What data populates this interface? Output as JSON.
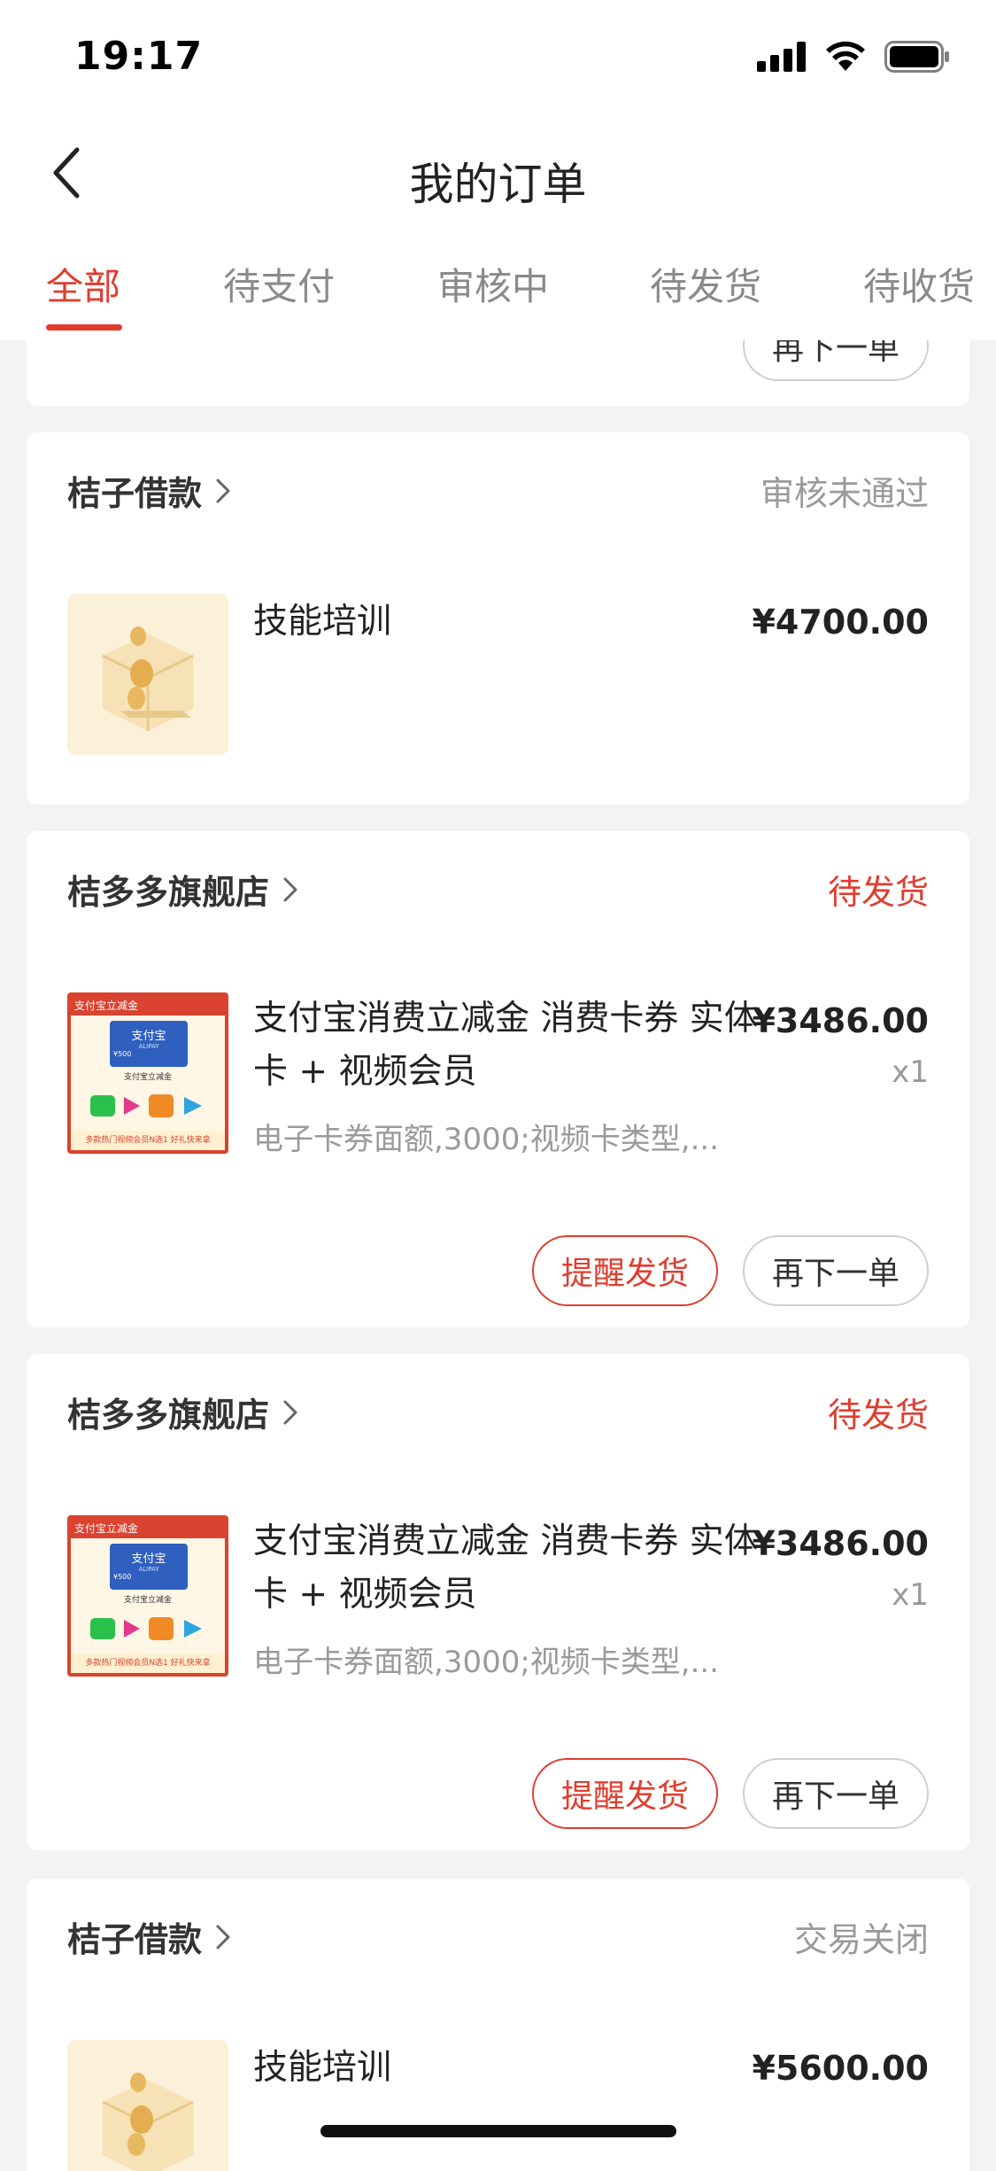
{
  "status_bar": {
    "time": "19:17"
  },
  "nav": {
    "title": "我的订单"
  },
  "tabs": [
    {
      "label": "全部",
      "active": true
    },
    {
      "label": "待支付",
      "active": false
    },
    {
      "label": "审核中",
      "active": false
    },
    {
      "label": "待发货",
      "active": false
    },
    {
      "label": "待收货",
      "active": false
    }
  ],
  "partial_card": {
    "reorder_label": "再下一单"
  },
  "orders": [
    {
      "shop": "桔子借款",
      "status": "审核未通过",
      "item": {
        "name": "技能培训",
        "price": "¥4700.00"
      }
    },
    {
      "shop": "桔多多旗舰店",
      "status": "待发货",
      "item": {
        "name": "支付宝消费立减金 消费卡券 实体卡 + 视频会员",
        "price": "¥3486.00",
        "qty": "x1",
        "spec": "电子卡券面额,3000;视频卡类型,..."
      },
      "thumb": {
        "banner": "支付宝立减金",
        "logo": "支付宝",
        "sub": "ALIPAY",
        "amount": "¥500",
        "card_label": "支付宝立减金",
        "footer": "多款热门视频会员N选1 好礼快来拿"
      },
      "buttons": {
        "remind": "提醒发货",
        "reorder": "再下一单"
      }
    },
    {
      "shop": "桔多多旗舰店",
      "status": "待发货",
      "item": {
        "name": "支付宝消费立减金 消费卡券 实体卡 + 视频会员",
        "price": "¥3486.00",
        "qty": "x1",
        "spec": "电子卡券面额,3000;视频卡类型,..."
      },
      "thumb": {
        "banner": "支付宝立减金",
        "logo": "支付宝",
        "sub": "ALIPAY",
        "amount": "¥500",
        "card_label": "支付宝立减金",
        "footer": "多款热门视频会员N选1 好礼快来拿"
      },
      "buttons": {
        "remind": "提醒发货",
        "reorder": "再下一单"
      }
    },
    {
      "shop": "桔子借款",
      "status": "交易关闭",
      "item": {
        "name": "技能培训",
        "price": "¥5600.00"
      }
    }
  ],
  "colors": {
    "accent": "#e03d2f",
    "muted": "#9a9a9a",
    "background": "#f3f3f3"
  },
  "icons": [
    "back-arrow-icon",
    "chevron-right-icon",
    "signal-icon",
    "wifi-icon",
    "battery-icon",
    "coin-box-icon"
  ]
}
